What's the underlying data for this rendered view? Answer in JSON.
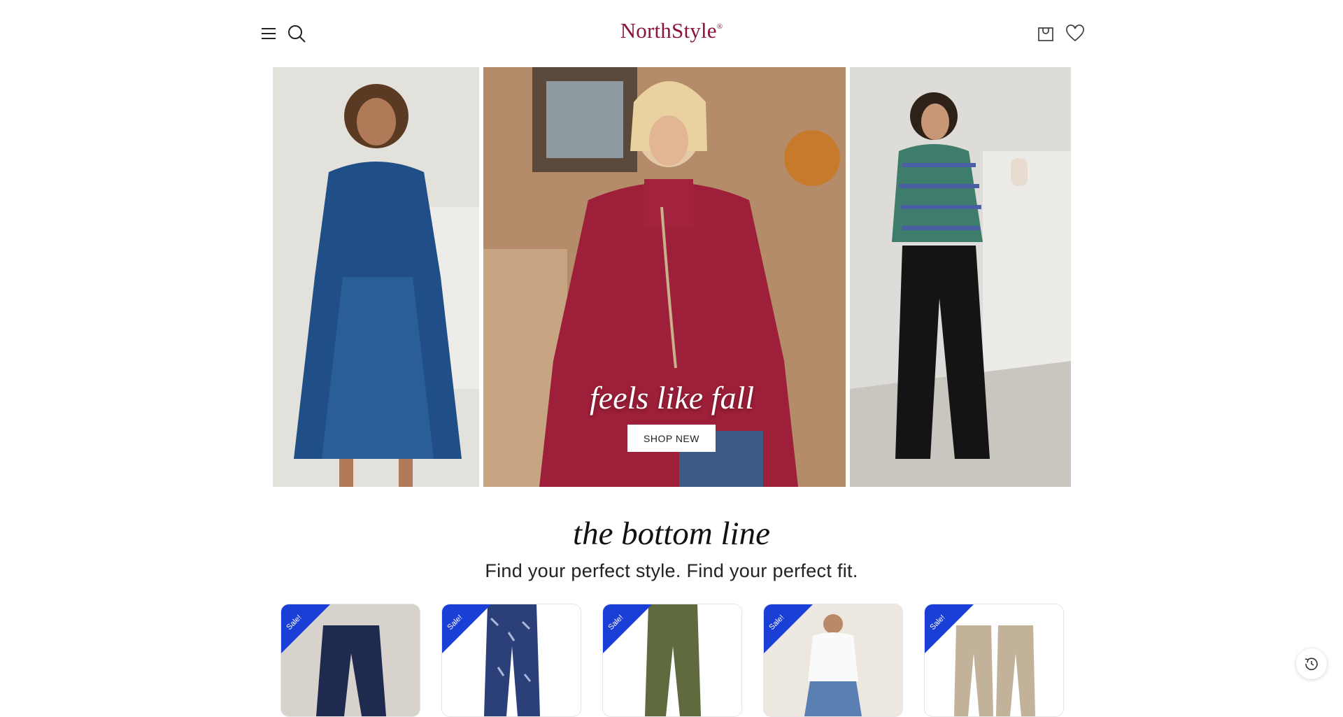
{
  "header": {
    "brand": "NorthStyle",
    "brand_mark": "®",
    "icons": [
      "menu-icon",
      "search-icon",
      "cart-icon",
      "wishlist-icon"
    ]
  },
  "hero": {
    "tagline": "feels like fall",
    "cta_label": "SHOP NEW"
  },
  "section": {
    "title": "the bottom line",
    "subtitle": "Find your perfect style. Find your perfect fit."
  },
  "products": [
    {
      "badge": "Sale!"
    },
    {
      "badge": "Sale!"
    },
    {
      "badge": "Sale!"
    },
    {
      "badge": "Sale!"
    },
    {
      "badge": "Sale!"
    }
  ],
  "colors": {
    "brand": "#8b1538",
    "sale_ribbon": "#1a3fd6"
  },
  "floating": {
    "icon": "history-icon"
  }
}
